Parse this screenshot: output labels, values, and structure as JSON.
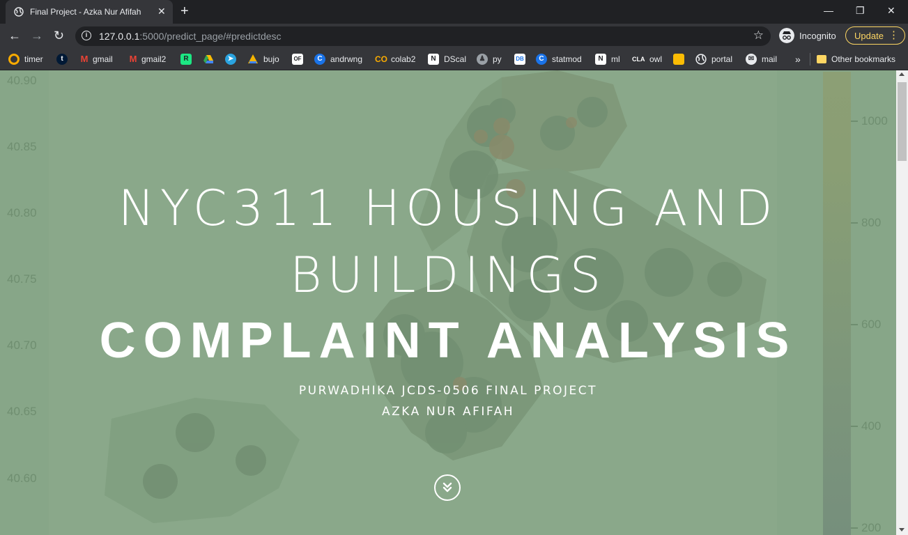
{
  "browser": {
    "tab_title": "Final Project - Azka Nur Afifah",
    "url_host": "127.0.0.1",
    "url_path": ":5000/predict_page/#predictdesc",
    "profile_label": "Incognito",
    "update_label": "Update"
  },
  "bookmarks": [
    {
      "label": "timer",
      "icon": "timer-icon",
      "color": "#f9ab00"
    },
    {
      "label": "",
      "icon": "tumblr-icon",
      "color": "#001935"
    },
    {
      "label": "gmail",
      "icon": "gmail-icon",
      "color": "#ea4335"
    },
    {
      "label": "gmail2",
      "icon": "gmail-icon",
      "color": "#ea4335"
    },
    {
      "label": "",
      "icon": "r-icon",
      "color": "#1ce783"
    },
    {
      "label": "",
      "icon": "drive-icon",
      "color": "#34a853"
    },
    {
      "label": "",
      "icon": "telegram-icon",
      "color": "#2aa3df"
    },
    {
      "label": "bujo",
      "icon": "bujo-icon",
      "color": "#f4b400"
    },
    {
      "label": "",
      "icon": "film-icon",
      "color": "#ffffff"
    },
    {
      "label": "andrwng",
      "icon": "c-icon",
      "color": "#1a73e8"
    },
    {
      "label": "colab2",
      "icon": "colab-icon",
      "color": "#f9ab00"
    },
    {
      "label": "DScal",
      "icon": "notion-icon",
      "color": "#ffffff"
    },
    {
      "label": "py",
      "icon": "py-icon",
      "color": "#9aa0a6"
    },
    {
      "label": "",
      "icon": "doc-icon",
      "color": "#ffffff"
    },
    {
      "label": "statmod",
      "icon": "c-icon",
      "color": "#1a73e8"
    },
    {
      "label": "ml",
      "icon": "notion-icon",
      "color": "#ffffff"
    },
    {
      "label": "owl",
      "icon": "cla-icon",
      "color": "#ffffff"
    },
    {
      "label": "",
      "icon": "note-icon",
      "color": "#fbbc04"
    },
    {
      "label": "portal",
      "icon": "globe-icon",
      "color": "#e8eaed"
    },
    {
      "label": "mail",
      "icon": "mail-icon",
      "color": "#e8eaed"
    }
  ],
  "other_bookmarks": "Other bookmarks",
  "hero": {
    "line1": "NYC311 HOUSING AND",
    "line2": "BUILDINGS",
    "line3": "COMPLAINT ANALYSIS",
    "sub1": "PURWADHIKA JCDS-0506 FINAL PROJECT",
    "sub2": "AZKA NUR AFIFAH"
  },
  "map": {
    "lat_labels": [
      "40.90",
      "40.85",
      "40.80",
      "40.75",
      "40.70",
      "40.65",
      "40.60"
    ],
    "colorbar_labels": [
      "1000",
      "800",
      "600",
      "400",
      "200"
    ],
    "background_color": "#87a688"
  }
}
